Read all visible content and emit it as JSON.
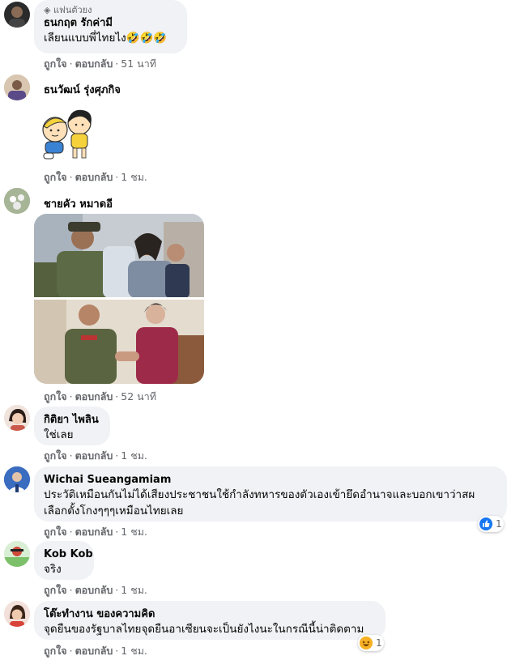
{
  "action_like": "ถูกใจ",
  "action_reply": "ตอบกลับ",
  "comments": [
    {
      "badge": "แฟนตัวยง",
      "name": "ธนกฤต รักค่ามี",
      "text": "เลียนแบบพี่ไทยไง🤣🤣🤣",
      "time": "51 นาที"
    },
    {
      "name": "ธนวัฒน์ รุ่งศุภกิจ",
      "time": "1 ชม.",
      "sticker": "cartoon-boy-girl-sticker"
    },
    {
      "name": "ชายคัว หมาดอี",
      "time": "52 นาที",
      "photo": "collage-two-meetings-photo"
    },
    {
      "name": "กิติยา ไพลิน",
      "text": "ใช่เลย",
      "time": "1 ชม."
    },
    {
      "name": "Wichai Sueangamiam",
      "text_line1": "ประวัติเหมือนกันไม่ได้เสียงประชาชนใช้กำลังทหารของตัวเองเข้ายึดอำนาจและบอกเขาว่าสผ",
      "text_line2": "เลือกตั้งโกงๆๆๆเหมือนไทยเลย",
      "time": "1 ชม.",
      "reaction_count": "1",
      "reaction": "like"
    },
    {
      "name": "Kob Kob",
      "text": "จริง",
      "time": "1 ชม."
    },
    {
      "name": "โต๊ะทำงาน ของความคิด",
      "text": "จุดยืนของรัฐบาลไทยจุดยืนอาเซียนจะเป็นยังไงนะในกรณีนี้น่าติดตาม",
      "time": "1 ชม.",
      "reaction_count": "1",
      "reaction": "haha"
    }
  ],
  "colors": {
    "bubble": "#f0f2f5",
    "meta": "#65676b",
    "like": "#1877f2",
    "haha": "#f7b125"
  }
}
